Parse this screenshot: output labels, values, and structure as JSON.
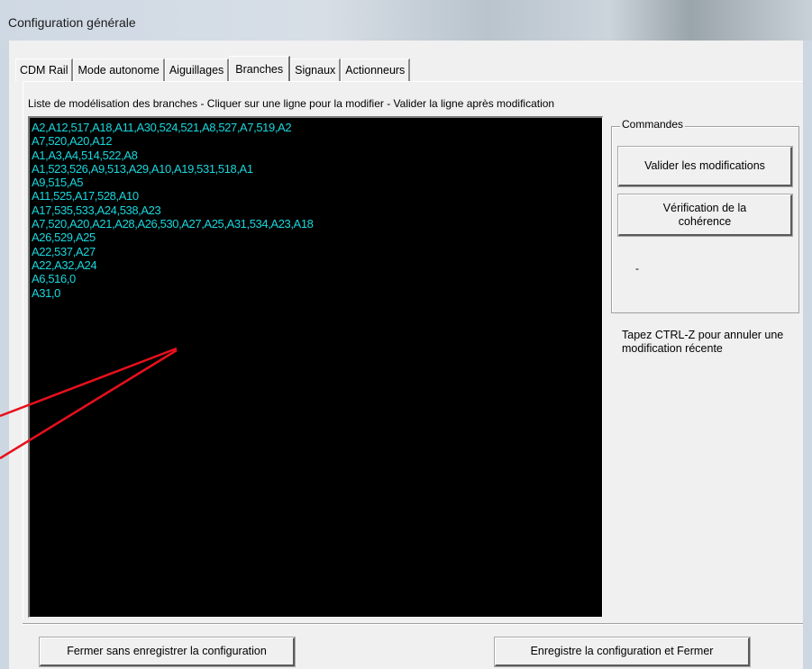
{
  "window": {
    "title": "Configuration générale"
  },
  "tabs": [
    {
      "label": "CDM Rail",
      "active": false
    },
    {
      "label": "Mode autonome",
      "active": false
    },
    {
      "label": "Aiguillages",
      "active": false
    },
    {
      "label": "Branches",
      "active": true
    },
    {
      "label": "Signaux",
      "active": false
    },
    {
      "label": "Actionneurs",
      "active": false
    }
  ],
  "branches": {
    "caption": "Liste de modélisation des branches - Cliquer sur une ligne pour la modifier - Valider la ligne après modification",
    "lines": [
      "A2,A12,517,A18,A11,A30,524,521,A8,527,A7,519,A2",
      "A7,520,A20,A12",
      "A1,A3,A4,514,522,A8",
      "A1,523,526,A9,513,A29,A10,A19,531,518,A1",
      "A9,515,A5",
      "A11,525,A17,528,A10",
      "A17,535,533,A24,538,A23",
      "A7,520,A20,A21,A28,A26,530,A27,A25,A31,534,A23,A18",
      "A26,529,A25",
      "A22,537,A27",
      "A22,A32,A24",
      "A6,516,0",
      "A31,0"
    ],
    "text_color": "#19d7dd",
    "background_color": "#000000"
  },
  "commands": {
    "title": "Commandes",
    "validate_label": "Valider les modifications",
    "check_label": "Vérification de la\ncohérence",
    "status": "-"
  },
  "hint": "Tapez CTRL-Z pour annuler une modification récente",
  "footer": {
    "close_nosave_label": "Fermer sans enregistrer la configuration",
    "save_close_label": "Enregistre la configuration et Fermer"
  },
  "annotation_color": "#e8101c"
}
